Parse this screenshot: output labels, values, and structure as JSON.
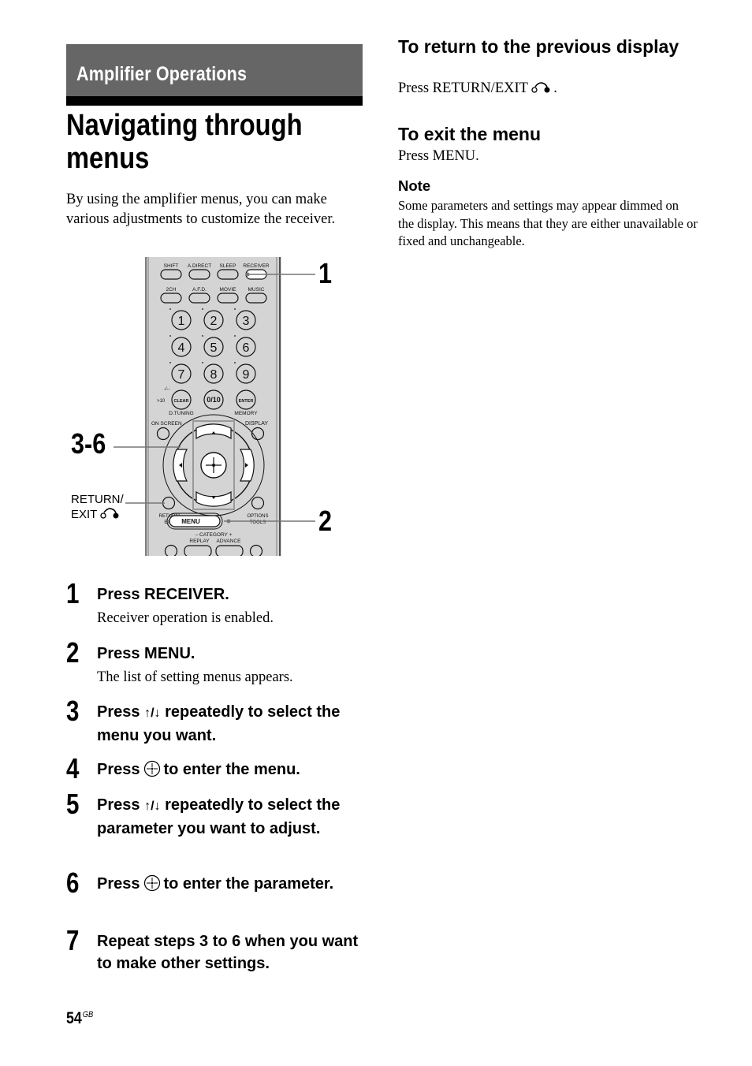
{
  "section_banner": "Amplifier Operations",
  "page_title": "Navigating through menus",
  "intro": "By using the amplifier menus, you can make various adjustments to customize the receiver.",
  "figure": {
    "callouts": {
      "c1": "1",
      "c2": "2",
      "c36": "3-6",
      "return_label_line1": "RETURN/",
      "return_label_line2": "EXIT"
    },
    "remote": {
      "row1": [
        "SHIFT",
        "A.DIRECT",
        "SLEEP",
        "RECEIVER"
      ],
      "row2": [
        "2CH",
        "A.F.D.",
        "MOVIE",
        "MUSIC"
      ],
      "digits": [
        "1",
        "2",
        "3",
        "4",
        "5",
        "6",
        "7",
        "8",
        "9"
      ],
      "bottom_keys": {
        "clear": "CLEAR",
        "zero": "0/10",
        "enter": "ENTER",
        "gt10": ">10",
        "dash": "-/--"
      },
      "d_tuning": "D.TUNING",
      "memory": "MEMORY",
      "on_screen": "ON SCREEN",
      "display": "DISPLAY",
      "return_exit_1": "RETURN/",
      "return_exit_2": "EXIT",
      "menu": "MENU",
      "options_1": "OPTIONS",
      "options_2": "TOOLS",
      "category": "– CATEGORY +",
      "replay": "REPLAY",
      "advance": "ADVANCE"
    }
  },
  "steps": [
    {
      "num": "1",
      "title": "Press RECEIVER.",
      "desc": "Receiver operation is enabled."
    },
    {
      "num": "2",
      "title": "Press MENU.",
      "desc": "The list of setting menus appears."
    },
    {
      "num": "3",
      "title_a": "Press ",
      "arrows": "↑/↓",
      "title_b": " repeatedly to select the menu you want."
    },
    {
      "num": "4",
      "title_a": "Press",
      "title_b": "to enter the menu."
    },
    {
      "num": "5",
      "title_a": "Press ",
      "arrows": "↑/↓",
      "title_b": " repeatedly to select the parameter you want to adjust."
    },
    {
      "num": "6",
      "title_a": "Press",
      "title_b": "to enter the parameter."
    },
    {
      "num": "7",
      "title": "Repeat steps 3 to 6 when you want to make other settings."
    }
  ],
  "right": {
    "return_heading": "To return to the previous display",
    "return_text": "Press RETURN/EXIT",
    "return_period": ".",
    "exit_heading": "To exit the menu",
    "exit_text": "Press MENU.",
    "note_heading": "Note",
    "note_text": "Some parameters and settings may appear dimmed on the display. This means that they are either unavailable or fixed and unchangeable."
  },
  "footer": {
    "page_number": "54",
    "region": "GB"
  }
}
